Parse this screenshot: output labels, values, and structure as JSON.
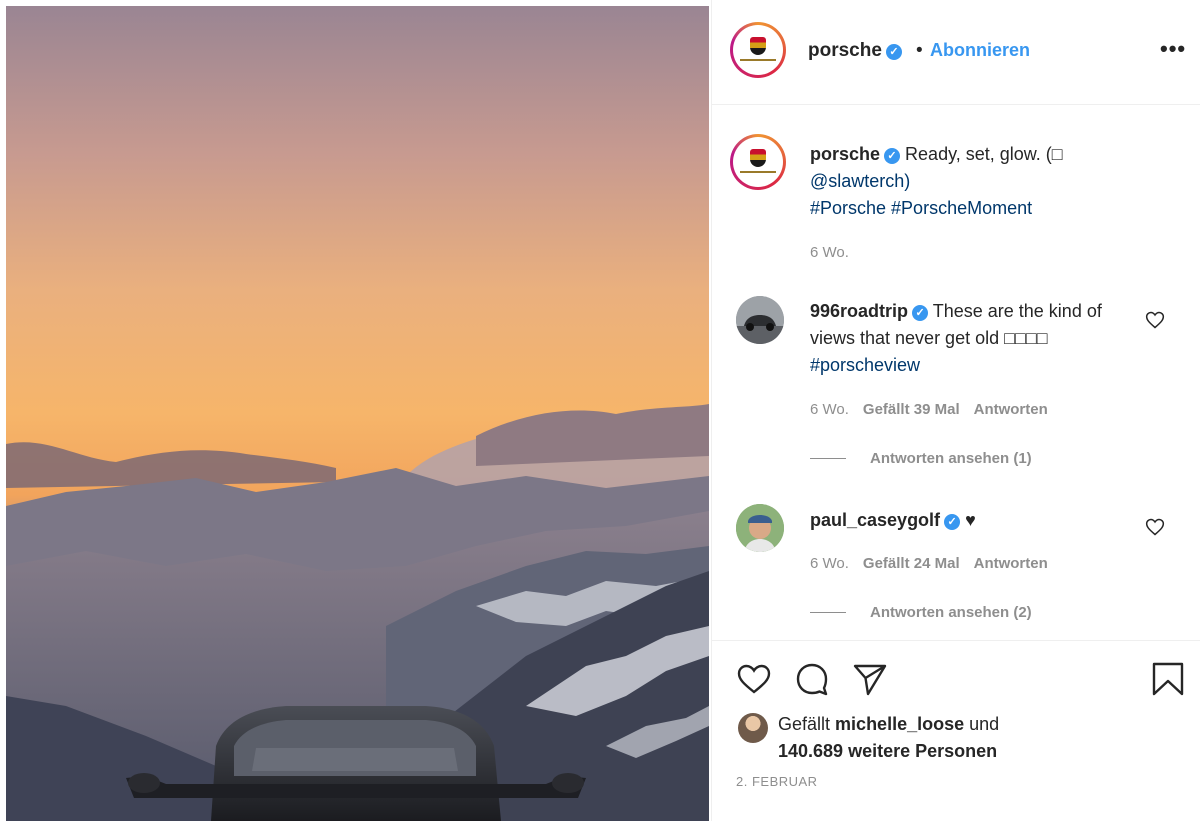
{
  "post": {
    "username": "porsche",
    "follow_separator": "•",
    "follow_label": "Abonnieren",
    "more_label": "•••"
  },
  "caption": {
    "username": "porsche",
    "text": "Ready, set, glow. (□",
    "mention": "@slawterch)",
    "hashtags": "#Porsche #PorscheMoment",
    "time": "6 Wo."
  },
  "comments": [
    {
      "username": "996roadtrip",
      "text": "These are the kind of views that never get old □□□□",
      "hashtag": "#porscheview",
      "time": "6 Wo.",
      "likes": "Gefällt 39 Mal",
      "reply_label": "Antworten",
      "view_replies": "Antworten ansehen (1)"
    },
    {
      "username": "paul_caseygolf",
      "text": "♥",
      "time": "6 Wo.",
      "likes": "Gefällt 24 Mal",
      "reply_label": "Antworten",
      "view_replies": "Antworten ansehen (2)"
    }
  ],
  "likes": {
    "prefix": "Gefällt",
    "user": "michelle_loose",
    "suffix": "und",
    "count_text": "140.689 weitere Personen"
  },
  "date": "2. FEBRUAR",
  "icons": {
    "verified": "verified-badge-icon",
    "like": "heart-icon",
    "comment": "comment-bubble-icon",
    "share": "paper-plane-icon",
    "save": "bookmark-icon"
  },
  "colors": {
    "link": "#00376b",
    "accent": "#3897f0",
    "muted": "#8e8e8e",
    "text": "#262626"
  }
}
